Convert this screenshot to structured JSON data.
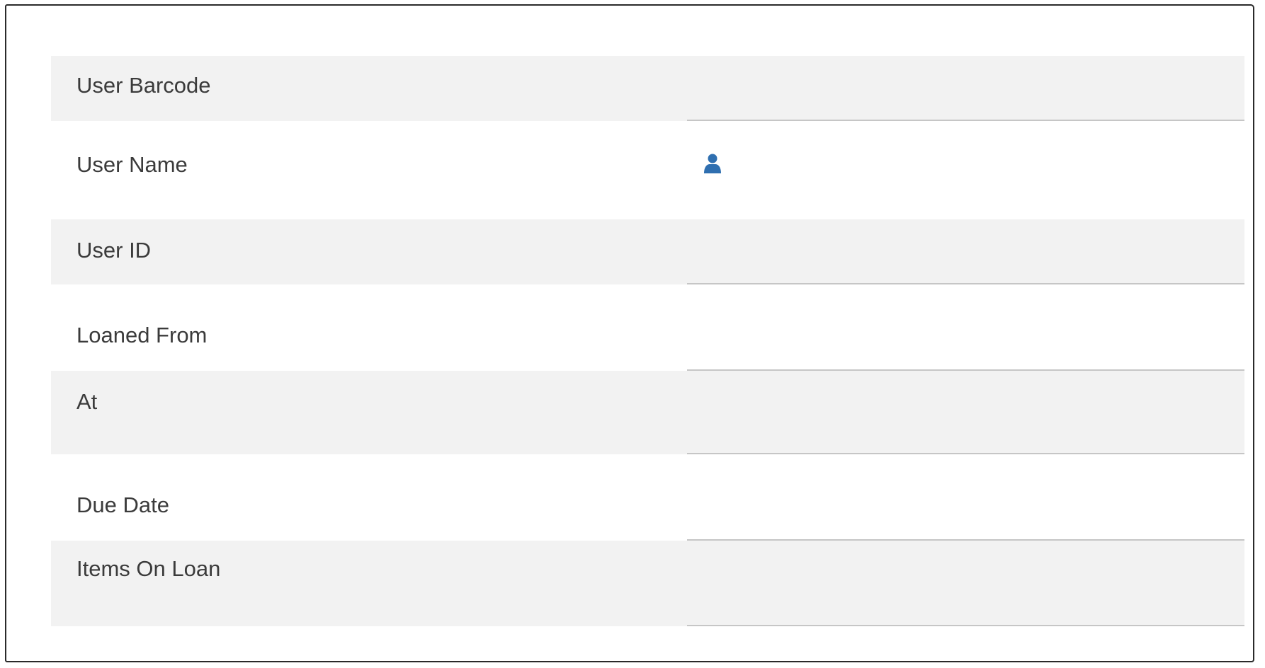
{
  "form": {
    "rows": [
      {
        "label": "User Barcode",
        "value": ""
      },
      {
        "label": "User Name",
        "value": "",
        "icon": "user-icon"
      },
      {
        "label": "User ID",
        "value": ""
      },
      {
        "label": "Loaned From",
        "value": ""
      },
      {
        "label": "At",
        "value": ""
      },
      {
        "label": "Due Date",
        "value": ""
      },
      {
        "label": "Items On Loan",
        "value": ""
      }
    ]
  },
  "colors": {
    "row_shade": "#f2f2f2",
    "label_text": "#3b3b3b",
    "underline": "#c6c6c6",
    "icon_blue": "#2f6fb0"
  }
}
